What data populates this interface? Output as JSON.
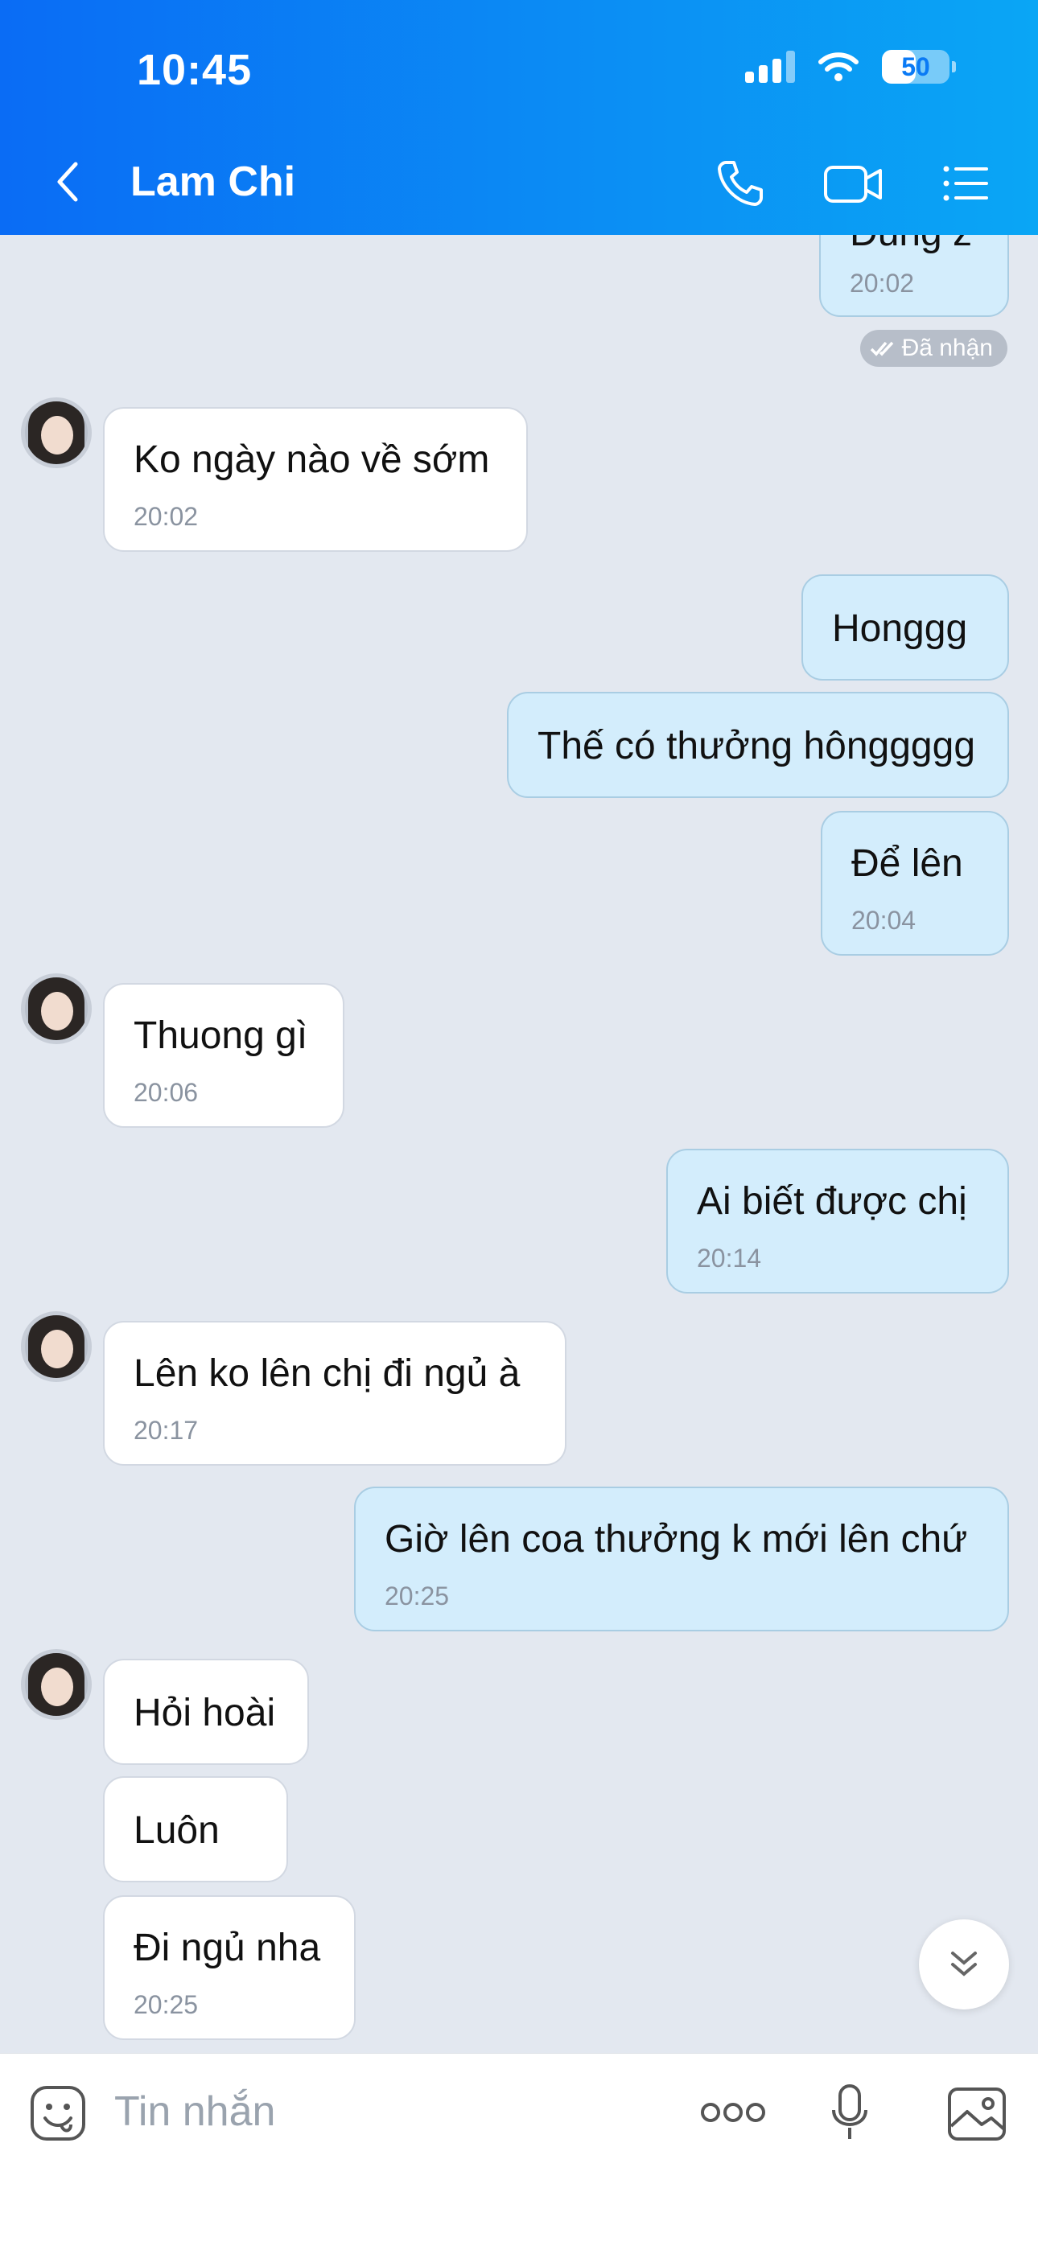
{
  "status_bar": {
    "time": "10:45",
    "battery": "50",
    "battery_level": 0.5
  },
  "header": {
    "contact_name": "Lam Chi"
  },
  "conversation": {
    "clipped_top": {
      "text": "Đúng z",
      "time": "20:02",
      "receipt": "Đã nhận"
    },
    "messages": [
      {
        "text": "Ko ngày nào về sớm",
        "time": "20:02"
      },
      {
        "text": "Honggg"
      },
      {
        "text": "Thế có thưởng hônggggg"
      },
      {
        "text": "Để lên",
        "time": "20:04"
      },
      {
        "text": "Thuong gì",
        "time": "20:06"
      },
      {
        "text": "Ai biết được chị",
        "time": "20:14"
      },
      {
        "text": "Lên ko lên chị đi ngủ à",
        "time": "20:17"
      },
      {
        "text": "Giờ lên coa thưởng k mới lên chứ",
        "time": "20:25"
      },
      {
        "text": "Hỏi hoài"
      },
      {
        "text": "Luôn"
      },
      {
        "text": "Đi ngủ nha",
        "time": "20:25"
      }
    ]
  },
  "composer": {
    "placeholder": "Tin nhắn"
  },
  "icons": {
    "back": "chevron-left-icon",
    "call": "phone-icon",
    "video": "video-camera-icon",
    "menu": "list-menu-icon",
    "sticker": "sticker-icon",
    "more": "more-dots-icon",
    "mic": "microphone-icon",
    "gallery": "image-icon",
    "scroll": "double-chevron-down-icon"
  },
  "colors": {
    "header_start": "#0a6cf5",
    "header_end": "#0aa6f5",
    "outgoing_bubble": "#d3edfc",
    "incoming_bubble": "#ffffff",
    "chat_bg": "#e3e8f0"
  }
}
